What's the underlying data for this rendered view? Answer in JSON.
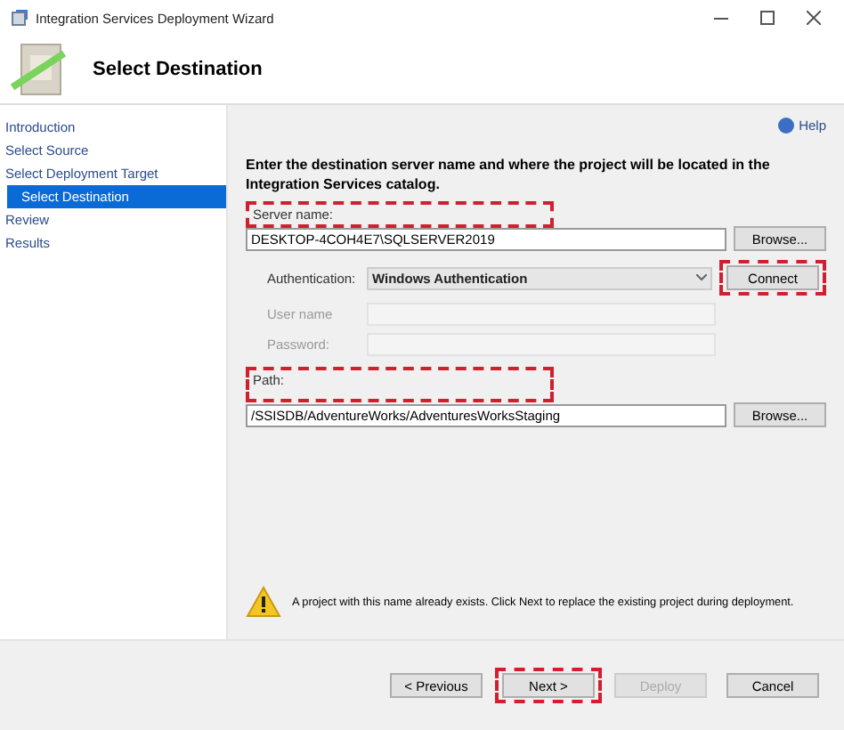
{
  "window": {
    "title": "Integration Services Deployment Wizard"
  },
  "header": {
    "title": "Select Destination"
  },
  "sidebar": {
    "items": [
      {
        "label": "Introduction",
        "selected": false
      },
      {
        "label": "Select Source",
        "selected": false
      },
      {
        "label": "Select Deployment Target",
        "selected": false,
        "children": [
          {
            "label": "Select Destination",
            "selected": true
          }
        ]
      },
      {
        "label": "Review",
        "selected": false
      },
      {
        "label": "Results",
        "selected": false
      }
    ]
  },
  "help": "Help",
  "description": "Enter the destination server name and where the project will be located in the Integration Services catalog.",
  "server": {
    "label": "Server name:",
    "value": "DESKTOP-4COH4E7\\SQLSERVER2019",
    "highlighted": true,
    "browse": "Browse..."
  },
  "authentication": {
    "label": "Authentication:",
    "value": "Windows Authentication",
    "connect": "Connect",
    "connect_highlighted": true
  },
  "user_name": {
    "label": "User name",
    "disabled": true
  },
  "password": {
    "label": "Password:",
    "disabled": true
  },
  "path": {
    "label": "Path:",
    "value": "/SSISDB/AdventureWorks/AdventuresWorksStaging",
    "highlighted": true,
    "browse": "Browse..."
  },
  "warning": "A project with this name already exists. Click Next to replace the existing project during deployment.",
  "buttons": [
    {
      "label": "< Previous",
      "disabled": false,
      "highlighted": false
    },
    {
      "label": "Next >",
      "disabled": false,
      "highlighted": true
    },
    {
      "label": "Deploy",
      "disabled": true,
      "highlighted": false
    },
    {
      "label": "Cancel",
      "disabled": false,
      "highlighted": false
    }
  ]
}
